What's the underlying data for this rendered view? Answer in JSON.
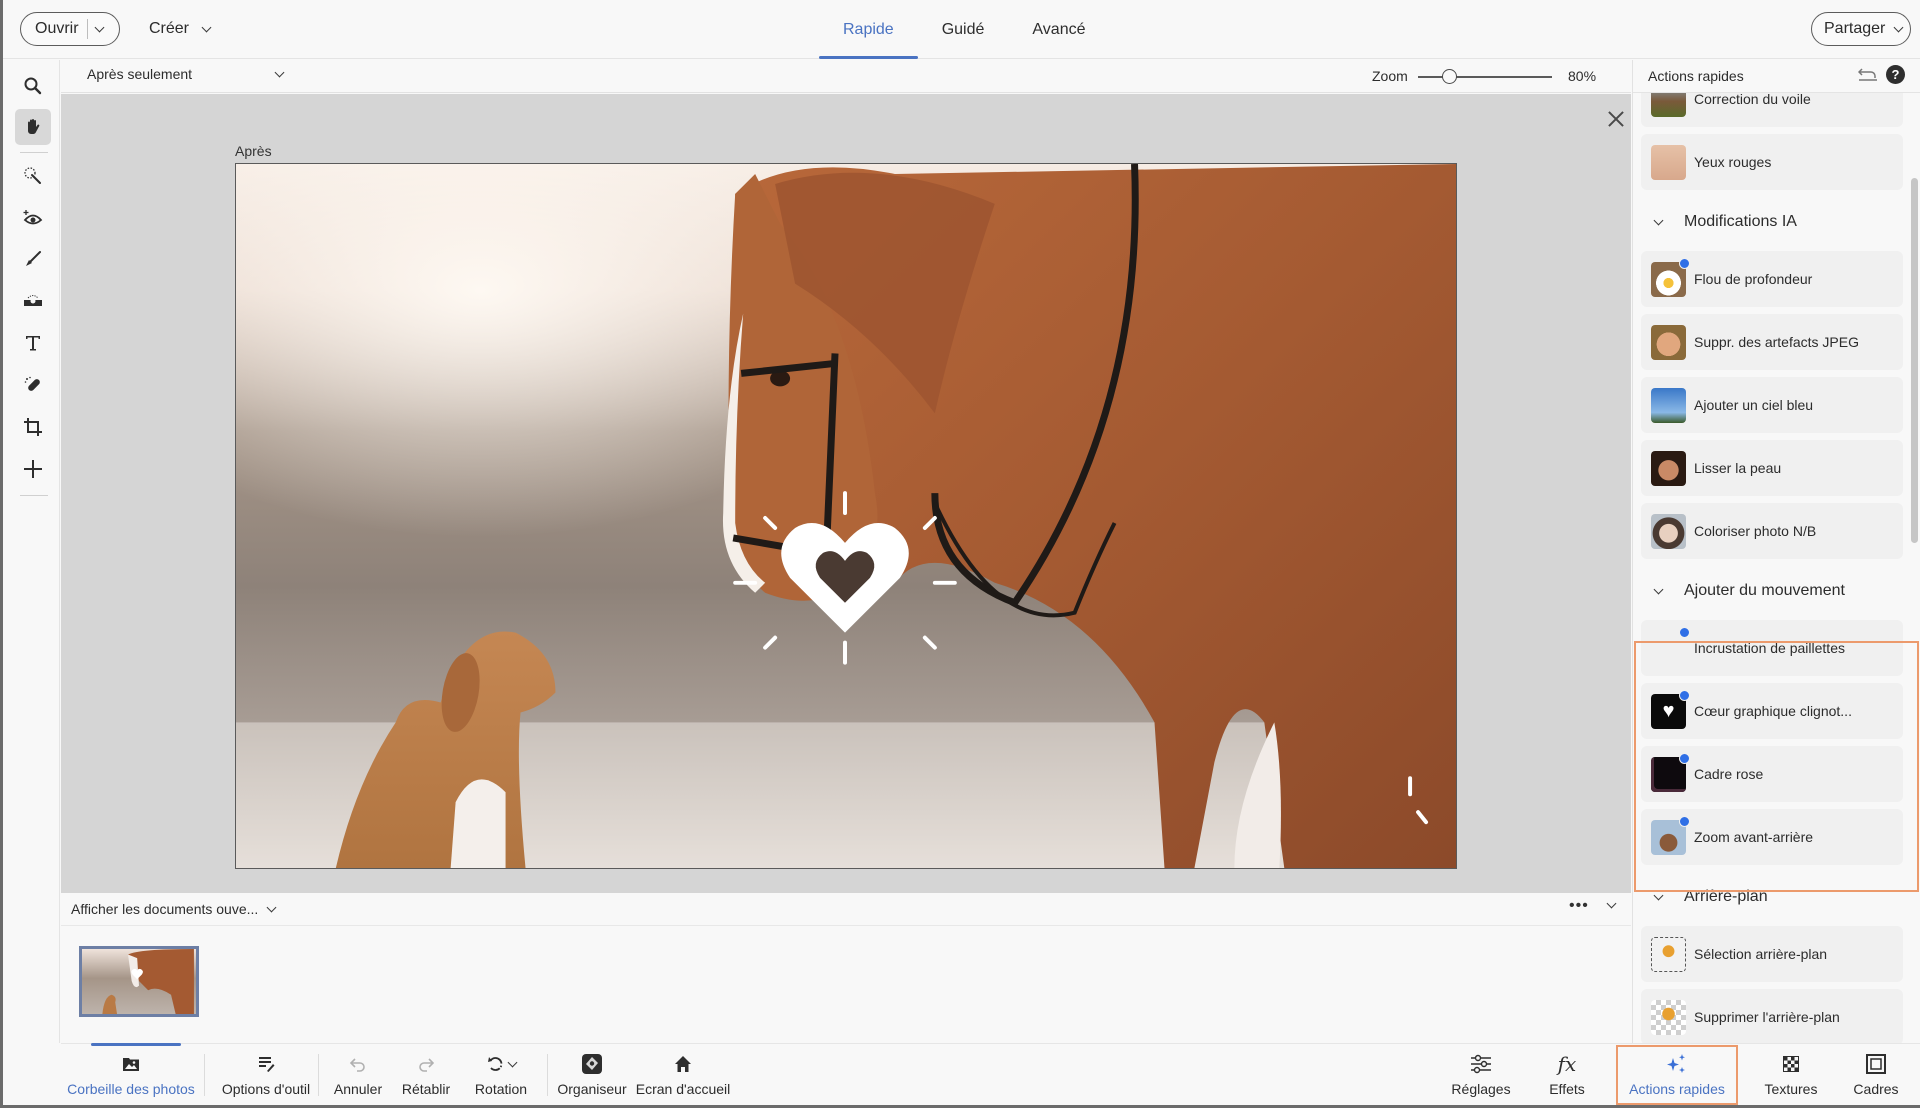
{
  "topbar": {
    "open_label": "Ouvrir",
    "create_label": "Créer",
    "share_label": "Partager",
    "tabs": [
      {
        "label": "Rapide",
        "active": true
      },
      {
        "label": "Guidé",
        "active": false
      },
      {
        "label": "Avancé",
        "active": false
      }
    ]
  },
  "toolbar": {
    "tools": [
      {
        "name": "zoom",
        "icon": "search-icon",
        "active": false
      },
      {
        "name": "hand",
        "icon": "hand-icon",
        "active": true
      },
      {
        "name": "quick-selection",
        "icon": "magic-wand-icon",
        "active": false
      },
      {
        "name": "red-eye",
        "icon": "eye-plus-icon",
        "active": false
      },
      {
        "name": "whiten-teeth",
        "icon": "brush-icon",
        "active": false
      },
      {
        "name": "straighten",
        "icon": "level-icon",
        "active": false
      },
      {
        "name": "type",
        "icon": "text-icon",
        "active": false
      },
      {
        "name": "spot-healing",
        "icon": "bandage-icon",
        "active": false
      },
      {
        "name": "crop",
        "icon": "crop-icon",
        "active": false
      },
      {
        "name": "move",
        "icon": "move-icon",
        "active": false
      }
    ]
  },
  "options": {
    "view_mode": "Après seulement",
    "zoom_label": "Zoom",
    "zoom_value": "80%",
    "zoom_fraction": 0.23
  },
  "canvas": {
    "view_label": "Après",
    "image_description": "Horse and dog in snowy field with heart graphic overlay"
  },
  "bin": {
    "selector_label": "Afficher les documents ouve...",
    "more_label": "•••"
  },
  "bottombar": {
    "left": [
      {
        "label": "Corbeille des photos",
        "icon": "photo-bin-icon",
        "active": true
      },
      {
        "label": "Options d'outil",
        "icon": "tool-options-icon"
      },
      {
        "label": "Annuler",
        "icon": "undo-icon",
        "disabled": true
      },
      {
        "label": "Rétablir",
        "icon": "redo-icon",
        "disabled": true
      },
      {
        "label": "Rotation",
        "icon": "rotate-icon"
      },
      {
        "label": "Organiseur",
        "icon": "organizer-icon"
      },
      {
        "label": "Ecran d'accueil",
        "icon": "home-icon"
      }
    ],
    "right": [
      {
        "label": "Réglages",
        "icon": "sliders-icon"
      },
      {
        "label": "Effets",
        "icon": "fx-icon"
      },
      {
        "label": "Actions rapides",
        "icon": "sparkles-icon",
        "active": true
      },
      {
        "label": "Textures",
        "icon": "texture-icon"
      },
      {
        "label": "Cadres",
        "icon": "frame-icon"
      }
    ]
  },
  "panel": {
    "title": "Actions rapides",
    "reset_icon": "reset-icon",
    "help_label": "?",
    "sections": [
      {
        "items": [
          {
            "label": "Correction du voile",
            "thumb": "barn-landscape",
            "new": false
          },
          {
            "label": "Yeux rouges",
            "thumb": "face-eyes",
            "new": false
          }
        ]
      },
      {
        "title": "Modifications IA",
        "items": [
          {
            "label": "Flou de profondeur",
            "thumb": "daisy",
            "new": true
          },
          {
            "label": "Suppr. des artefacts JPEG",
            "thumb": "smiling-face",
            "new": false
          },
          {
            "label": "Ajouter un ciel bleu",
            "thumb": "blue-sky",
            "new": false
          },
          {
            "label": "Lisser la peau",
            "thumb": "woman-portrait",
            "new": false
          },
          {
            "label": "Coloriser photo N/B",
            "thumb": "vintage-portrait",
            "new": false
          }
        ]
      },
      {
        "title": "Ajouter du mouvement",
        "highlighted": true,
        "items": [
          {
            "label": "Incrustation de paillettes",
            "thumb": "sparkles-black",
            "new": true
          },
          {
            "label": "Cœur graphique clignot...",
            "thumb": "heart-black",
            "new": true
          },
          {
            "label": "Cadre rose",
            "thumb": "pink-frame",
            "new": true
          },
          {
            "label": "Zoom avant-arrière",
            "thumb": "zoom-photo",
            "new": true
          }
        ]
      },
      {
        "title": "Arrière-plan",
        "items": [
          {
            "label": "Sélection arrière-plan",
            "thumb": "bird-selection",
            "new": false
          },
          {
            "label": "Supprimer l'arrière-plan",
            "thumb": "bird-transparent",
            "new": false
          }
        ]
      }
    ]
  },
  "colors": {
    "accent": "#4a73c2",
    "highlight": "#ec9a6c",
    "new_badge": "#2f6fe6"
  }
}
